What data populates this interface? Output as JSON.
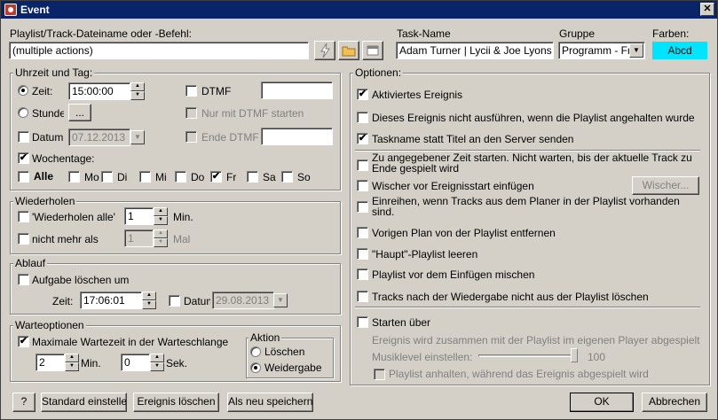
{
  "window": {
    "title": "Event",
    "close_glyph": "✕"
  },
  "header": {
    "playlist_label": "Playlist/Track-Dateiname oder -Befehl:",
    "playlist_value": "(multiple actions)",
    "taskname_label": "Task-Name",
    "taskname_value": "Adam Turner | Lycii & Joe Lyons",
    "gruppe_label": "Gruppe",
    "gruppe_value": "Programm - Fr",
    "farben_label": "Farben:",
    "farben_value": "Abcd",
    "farben_color": "#00e5ff",
    "icon_buttons": [
      "lightning-icon",
      "folder-icon",
      "window-icon"
    ]
  },
  "uhrzeit": {
    "legend": "Uhrzeit und Tag:",
    "zeit_label": "Zeit:",
    "zeit_value": "15:00:00",
    "stunde_label": "Stunde",
    "stunde_button": "...",
    "datum_label": "Datum",
    "datum_value": "07.12.2013",
    "dtmf_label": "DTMF",
    "dtmf_value": "",
    "nur_dtmf_label": "Nur mit DTMF starten",
    "ende_dtmf_label": "Ende DTMF",
    "ende_dtmf_value": "",
    "wochentage_label": "Wochentage:",
    "alle_label": "Alle",
    "days": [
      {
        "label": "Mo",
        "checked": false
      },
      {
        "label": "Di",
        "checked": false
      },
      {
        "label": "Mi",
        "checked": false
      },
      {
        "label": "Do",
        "checked": false
      },
      {
        "label": "Fr",
        "checked": true
      },
      {
        "label": "Sa",
        "checked": false
      },
      {
        "label": "So",
        "checked": false
      }
    ]
  },
  "wiederholen": {
    "legend": "Wiederholen",
    "alle_label": "'Wiederholen alle'",
    "alle_value": "1",
    "alle_unit": "Min.",
    "nicht_mehr_label": "nicht mehr als",
    "nicht_mehr_value": "1",
    "nicht_mehr_unit": "Mal"
  },
  "ablauf": {
    "legend": "Ablauf",
    "loeschen_label": "Aufgabe löschen um",
    "zeit_label": "Zeit:",
    "zeit_value": "17:06:01",
    "datum_label": "Datum",
    "datum_value": "29.08.2013"
  },
  "warteoptionen": {
    "legend": "Warteoptionen",
    "max_label": "Maximale Wartezeit in der Warteschlange",
    "min_value": "2",
    "min_unit": "Min.",
    "sek_value": "0",
    "sek_unit": "Sek.",
    "aktion_legend": "Aktion",
    "loeschen_label": "Löschen",
    "weidergabe_label": "Weidergabe"
  },
  "optionen": {
    "legend": "Optionen:",
    "items": [
      {
        "label": "Aktiviertes Ereignis",
        "checked": true
      },
      {
        "label": "Dieses Ereignis nicht ausführen, wenn die Playlist angehalten wurde",
        "checked": false
      },
      {
        "label": "Taskname statt Titel an den Server senden",
        "checked": true
      }
    ],
    "zu_angegebener": "Zu angegebener Zeit starten. Nicht warten, bis der aktuelle Track zu Ende gespielt wird",
    "wischer_label": "Wischer vor Ereignisstart einfügen",
    "wischer_button": "Wischer...",
    "einreihen": "Einreihen, wenn Tracks aus dem Planer in der Playlist vorhanden sind.",
    "items2": [
      {
        "label": "Vorigen Plan von der Playlist entfernen",
        "checked": false
      },
      {
        "label": "\"Haupt\"-Playlist leeren",
        "checked": false
      },
      {
        "label": "Playlist vor dem Einfügen mischen",
        "checked": false
      },
      {
        "label": "Tracks nach der Wiedergabe nicht aus der Playlist löschen",
        "checked": false
      }
    ],
    "starten_label": "Starten über",
    "ereignis_info": "Ereignis wird zusammen mit der Playlist im eigenen Player abgespielt",
    "musiklevel_label": "Musiklevel einstellen:",
    "musiklevel_value": "100",
    "playlist_anhalten": "Playlist anhalten, während das Ereignis abgespielt wird"
  },
  "footer": {
    "help": "?",
    "standard": "Standard einstellen",
    "ereignis_loeschen": "Ereignis löschen",
    "als_neu": "Als neu speichern",
    "ok": "OK",
    "abbrechen": "Abbrechen"
  }
}
